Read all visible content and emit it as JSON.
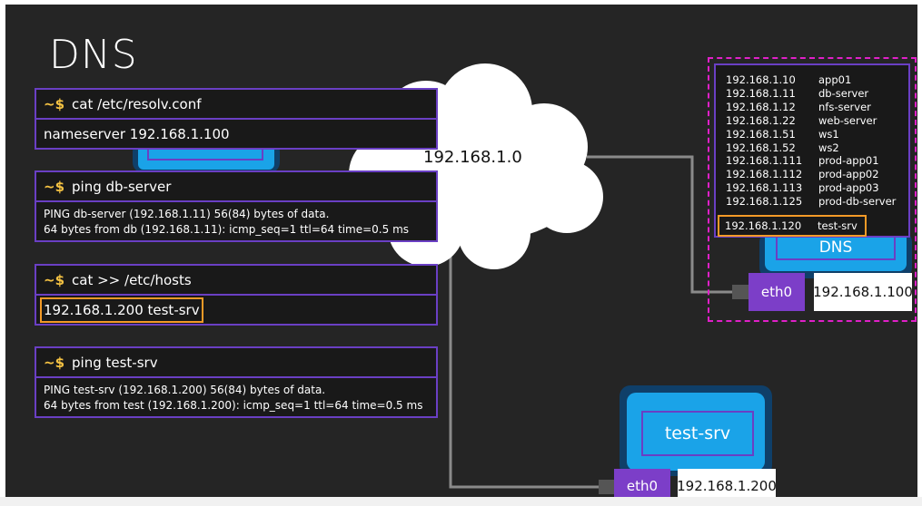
{
  "title": "DNS",
  "network_label": "192.168.1.0",
  "prompt_symbol": "~$",
  "terminals": [
    {
      "command": "cat  /etc/resolv.conf",
      "output": [
        "nameserver  192.168.1.100"
      ]
    },
    {
      "command": "ping  db-server",
      "output": [
        "PING db-server (192.168.1.11) 56(84) bytes of data.",
        "64 bytes from db (192.168.1.11): icmp_seq=1 ttl=64 time=0.5 ms"
      ]
    },
    {
      "command": "cat  >>  /etc/hosts",
      "output": [
        "192.168.1.200  test-srv"
      ]
    },
    {
      "command": "ping  test-srv",
      "output": [
        "PING test-srv (192.168.1.200) 56(84) bytes of data.",
        "64 bytes from test (192.168.1.200): icmp_seq=1 ttl=64 time=0.5 ms"
      ]
    }
  ],
  "dns_records": [
    {
      "ip": "192.168.1.10",
      "name": "app01"
    },
    {
      "ip": "192.168.1.11",
      "name": "db-server"
    },
    {
      "ip": "192.168.1.12",
      "name": "nfs-server"
    },
    {
      "ip": "192.168.1.22",
      "name": "web-server"
    },
    {
      "ip": "192.168.1.51",
      "name": "ws1"
    },
    {
      "ip": "192.168.1.52",
      "name": "ws2"
    },
    {
      "ip": "192.168.1.111",
      "name": "prod-app01"
    },
    {
      "ip": "192.168.1.112",
      "name": "prod-app02"
    },
    {
      "ip": "192.168.1.113",
      "name": "prod-app03"
    },
    {
      "ip": "192.168.1.125",
      "name": "prod-db-server"
    }
  ],
  "dns_new_record": {
    "ip": "192.168.1.120",
    "name": "test-srv"
  },
  "dns_server": {
    "label": "DNS",
    "interface": "eth0",
    "ip": "192.168.1.100"
  },
  "test_server": {
    "label": "test-srv",
    "interface": "eth0",
    "ip": "192.168.1.200"
  },
  "colors": {
    "background": "#252525",
    "terminal_border": "#6a3fc4",
    "highlight": "#f39a27",
    "prompt": "#f6c343",
    "screen": "#1aa3e8",
    "eth": "#7c3ec8",
    "dashed_border": "#e020c8"
  }
}
